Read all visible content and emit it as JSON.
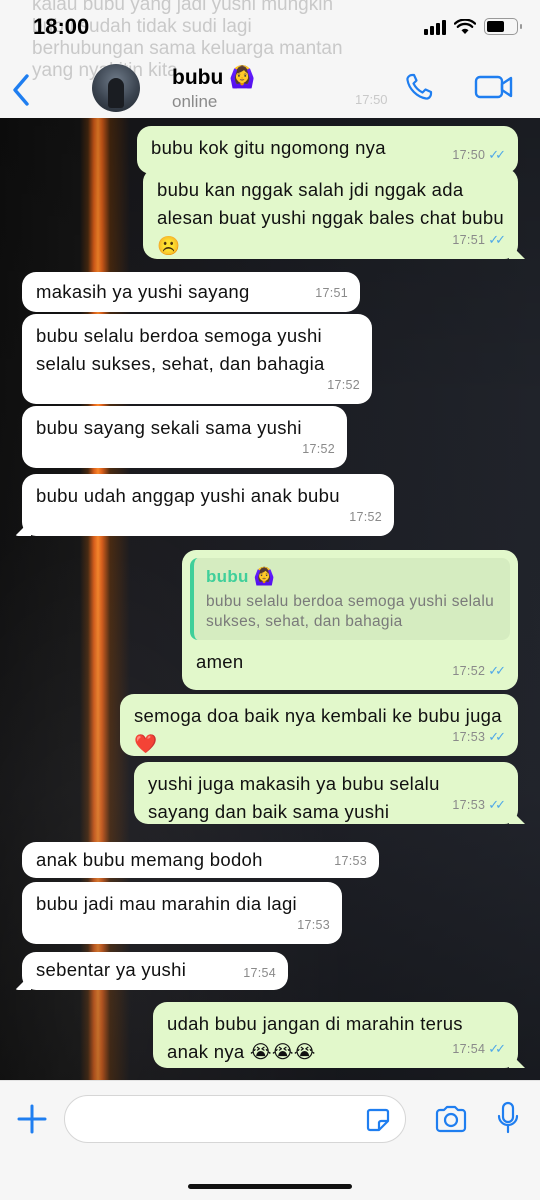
{
  "status_bar": {
    "time": "18:00"
  },
  "background_notification": {
    "lines": [
      "kalau bubu yang jadi yushi mungkin",
      "bubu sudah tidak sudi lagi",
      "berhubungan sama keluarga mantan",
      "yang nyakitin kita"
    ],
    "time": "17:50"
  },
  "header": {
    "back_icon": "chevron-left-icon",
    "name": "bubu 🙆‍♀️",
    "status": "online",
    "call_icon": "phone-icon",
    "video_icon": "video-icon",
    "accent_color": "#1f7ef0"
  },
  "messages": [
    {
      "dir": "out",
      "text": "bubu kok gitu ngomong nya",
      "time": "17:50",
      "read": true
    },
    {
      "dir": "out",
      "text": "bubu kan nggak salah jdi nggak ada alesan buat yushi nggak bales chat bubu ☹️",
      "time": "17:51",
      "read": true
    },
    {
      "dir": "in",
      "text": "makasih ya yushi sayang",
      "time": "17:51"
    },
    {
      "dir": "in",
      "text": "bubu selalu berdoa semoga yushi selalu sukses, sehat, dan bahagia",
      "time": "17:52"
    },
    {
      "dir": "in",
      "text": "bubu sayang sekali sama yushi",
      "time": "17:52"
    },
    {
      "dir": "in",
      "text": "bubu udah anggap yushi anak bubu",
      "time": "17:52"
    },
    {
      "dir": "out",
      "quote_name": "bubu 🙆‍♀️",
      "quote_text": "bubu selalu berdoa semoga yushi selalu sukses, sehat, dan bahagia",
      "text": "amen",
      "time": "17:52",
      "read": true
    },
    {
      "dir": "out",
      "text": "semoga doa baik nya kembali ke bubu juga ❤️",
      "time": "17:53",
      "read": true
    },
    {
      "dir": "out",
      "text": "yushi juga makasih ya bubu selalu sayang dan baik sama yushi",
      "time": "17:53",
      "read": true
    },
    {
      "dir": "in",
      "text": "anak bubu memang bodoh",
      "time": "17:53"
    },
    {
      "dir": "in",
      "text": "bubu jadi mau marahin dia lagi",
      "time": "17:53"
    },
    {
      "dir": "in",
      "text": "sebentar ya yushi",
      "time": "17:54"
    },
    {
      "dir": "out",
      "text": "udah bubu jangan di marahin terus anak nya 😭😭😭",
      "time": "17:54",
      "read": true
    }
  ],
  "input_bar": {
    "plus_icon": "plus-icon",
    "sticker_icon": "sticker-icon",
    "camera_icon": "camera-icon",
    "mic_icon": "microphone-icon"
  },
  "colors": {
    "incoming_bubble": "#ffffff",
    "outgoing_bubble": "#e2f8cb",
    "read_ticks": "#4fa8e8",
    "quote_accent": "#3fcf9a"
  }
}
